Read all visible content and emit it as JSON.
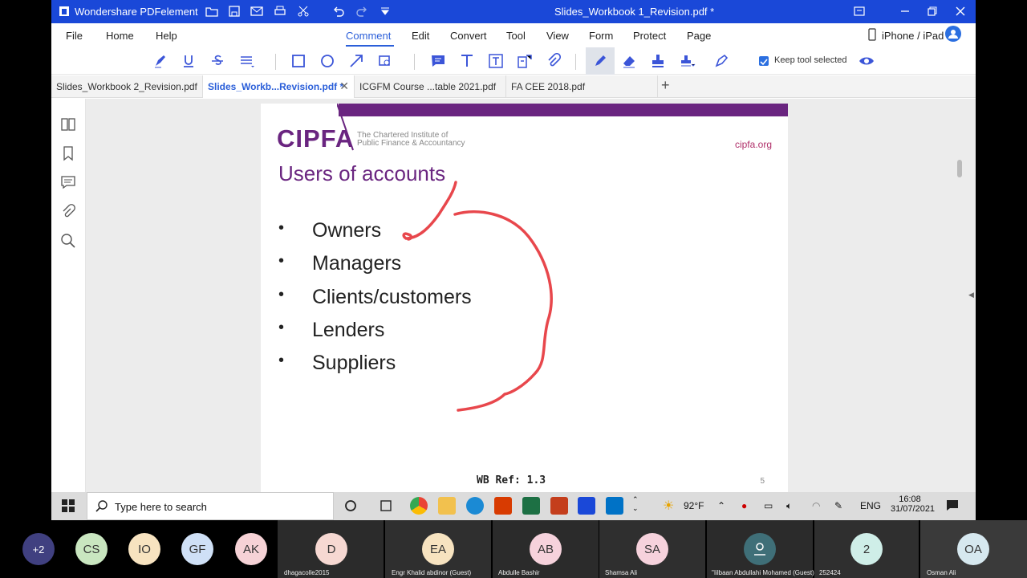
{
  "app": {
    "name": "Wondershare PDFelement",
    "document_title": "Slides_Workbook 1_Revision.pdf *"
  },
  "menu": {
    "items": [
      "File",
      "Home",
      "Help",
      "Comment",
      "Edit",
      "Convert",
      "Tool",
      "View",
      "Form",
      "Protect",
      "Page"
    ],
    "active": "Comment",
    "device": "iPhone / iPad"
  },
  "toolbar": {
    "keep_tool_label": "Keep tool selected",
    "keep_tool_checked": true
  },
  "tabs": [
    {
      "label": "Slides_Workbook 2_Revision.pdf",
      "active": false
    },
    {
      "label": "Slides_Workb...Revision.pdf *",
      "active": true
    },
    {
      "label": "ICGFM  Course ...table 2021.pdf",
      "active": false
    },
    {
      "label": "FA CEE 2018.pdf",
      "active": false
    }
  ],
  "slide": {
    "logo": "CIPFA",
    "logo_sub1": "The Chartered Institute of",
    "logo_sub2": "Public Finance & Accountancy",
    "site": "cipfa.org",
    "title": "Users of accounts",
    "bullets": [
      "Owners",
      "Managers",
      "Clients/customers",
      "Lenders",
      "Suppliers"
    ],
    "wb_ref": "WB Ref: 1.3",
    "page_number": "5"
  },
  "taskbar": {
    "search_placeholder": "Type here to search",
    "weather": "92°F",
    "language": "ENG",
    "time": "16:08",
    "date": "31/07/2021"
  },
  "participants": [
    {
      "initials": "+2",
      "name": ""
    },
    {
      "initials": "CS",
      "name": ""
    },
    {
      "initials": "IO",
      "name": ""
    },
    {
      "initials": "GF",
      "name": ""
    },
    {
      "initials": "AK",
      "name": ""
    },
    {
      "initials": "D",
      "name": "dhagacolle2015"
    },
    {
      "initials": "EA",
      "name": "Engr Khalid abdinor (Guest)"
    },
    {
      "initials": "AB",
      "name": "Abdulle Bashir"
    },
    {
      "initials": "SA",
      "name": "Shamsa Ali"
    },
    {
      "initials": "",
      "name": "\"Iilbaan Abdullahi Mohamed (Guest)\""
    },
    {
      "initials": "2",
      "name": "252424"
    },
    {
      "initials": "OA",
      "name": "Osman Ali"
    }
  ],
  "colors": {
    "titlebar": "#1a48d8",
    "accent": "#2b5fd9",
    "cipfa_purple": "#6a2580",
    "annotation": "#e8474c"
  }
}
